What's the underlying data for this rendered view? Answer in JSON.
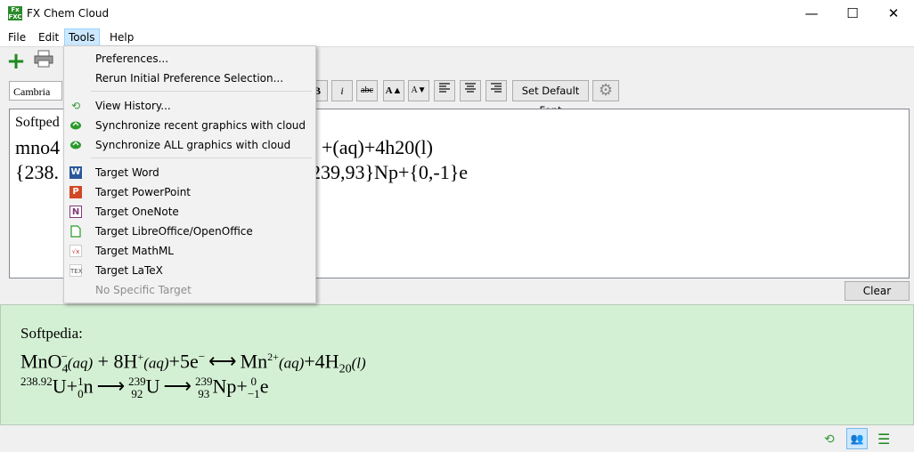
{
  "window": {
    "title": "FX Chem Cloud",
    "app_icon": "Fx\nFXC",
    "minimize": "—",
    "maximize": "☐",
    "close": "✕"
  },
  "menubar": [
    "File",
    "Edit",
    "Tools",
    "Help"
  ],
  "toolbar": {
    "add_icon": "+",
    "print_icon": "🖨"
  },
  "format": {
    "font": "Cambria",
    "bold": "B",
    "italic": "i",
    "strike": "abc",
    "grow": "A▲",
    "shrink": "A▼",
    "set_default_font": "Set Default Font"
  },
  "editor": {
    "lines": [
      "Softped",
      "mno4",
      "{238.",
      "+(aq)+4h20(l)",
      "239,93}Np+{0,-1}e"
    ]
  },
  "clear_label": "Clear",
  "preview": {
    "line1": "Softpedia:",
    "mno": "MnO",
    "sub4": "4",
    "minus": "−",
    "aq1": "(aq)",
    "plus8h": " + 8H",
    "plusSup": "+",
    "aq2": "(aq)",
    "plus5e": "+5e",
    "esup": "−",
    "arrow": "⟷",
    "mn": "Mn",
    "mnsup": "2+",
    "aq3": "(aq)",
    "plus4h": "+4H",
    "sub20": "20",
    "l": "(l)",
    "u_pre_sup": "238.92",
    "u": "U",
    "plus1": "+",
    "n_sup": "1",
    "n_sub": "0",
    "n": "n",
    "arr": "⟶",
    "u2_sup": "239",
    "u2_sub": "92",
    "u2": "U",
    "np_sup": "239",
    "np_sub": "93",
    "np": "Np+",
    "e_sup": "0",
    "e_sub": "−1",
    "e": "e"
  },
  "tools_menu": {
    "items": [
      {
        "label": "Preferences...",
        "icon": ""
      },
      {
        "label": "Rerun Initial Preference Selection...",
        "icon": ""
      },
      {
        "label": "View History...",
        "icon": "history-icon"
      },
      {
        "label": "Synchronize recent graphics with cloud",
        "icon": "cloud-sync-icon"
      },
      {
        "label": "Synchronize ALL graphics with cloud",
        "icon": "cloud-sync-icon"
      },
      {
        "label": "Target Word",
        "icon": "word-icon"
      },
      {
        "label": "Target PowerPoint",
        "icon": "powerpoint-icon"
      },
      {
        "label": "Target OneNote",
        "icon": "onenote-icon"
      },
      {
        "label": "Target LibreOffice/OpenOffice",
        "icon": "libreoffice-icon"
      },
      {
        "label": "Target MathML",
        "icon": "mathml-icon"
      },
      {
        "label": "Target LaTeX",
        "icon": "latex-icon"
      },
      {
        "label": "No Specific Target",
        "icon": ""
      }
    ]
  },
  "colors": {
    "preview_bg": "#d4f0d4",
    "accent": "#1f8a1f",
    "menu_highlight": "#cce8ff"
  }
}
